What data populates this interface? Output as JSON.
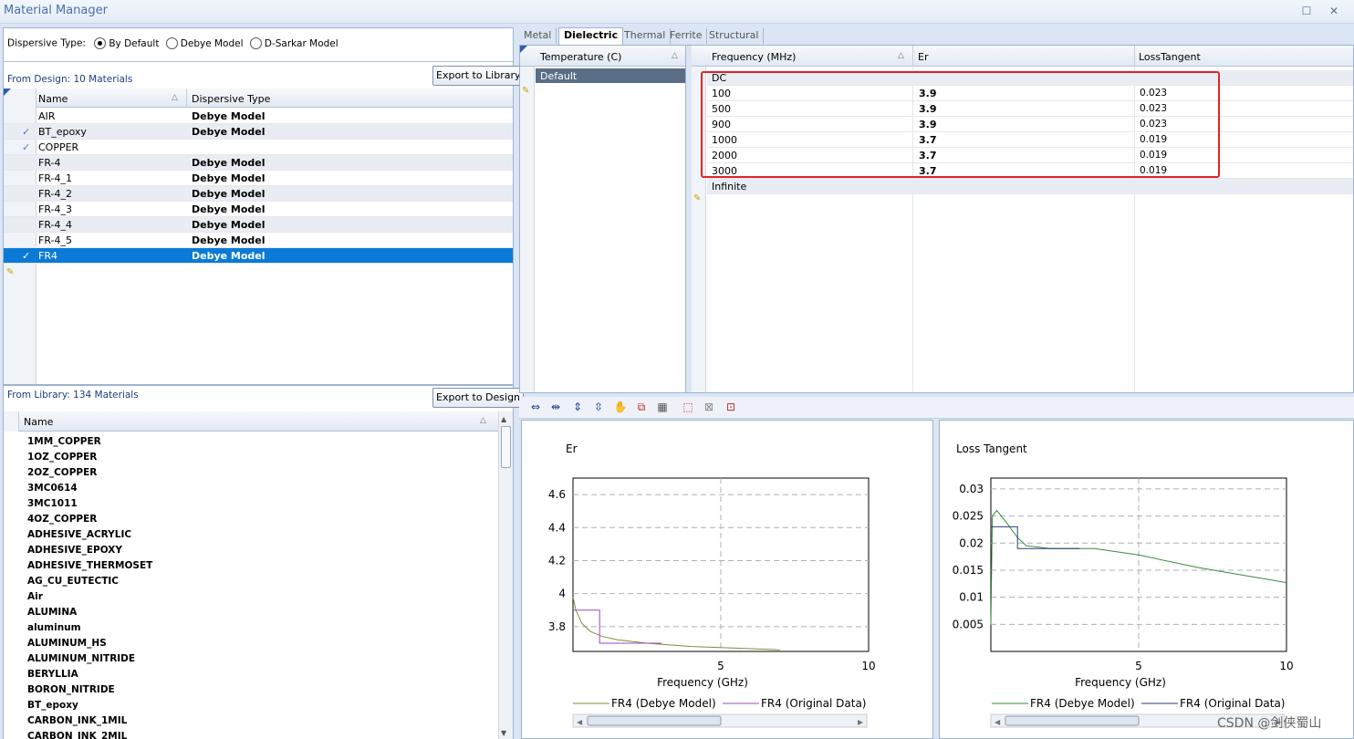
{
  "window": {
    "title": "Material Manager"
  },
  "left": {
    "dispersive_label": "Dispersive Type:",
    "options": [
      "By Default",
      "Debye Model",
      "D-Sarkar Model"
    ],
    "design_label": "From Design: 10 Materials",
    "export_library": "Export to Library",
    "design_cols": [
      "Name",
      "Dispersive Type"
    ],
    "design_rows": [
      {
        "name": "AIR",
        "type": "Debye Model",
        "check": ""
      },
      {
        "name": "BT_epoxy",
        "type": "Debye Model",
        "check": "✓"
      },
      {
        "name": "COPPER",
        "type": "",
        "check": "✓"
      },
      {
        "name": "FR-4",
        "type": "Debye Model",
        "check": ""
      },
      {
        "name": "FR-4_1",
        "type": "Debye Model",
        "check": ""
      },
      {
        "name": "FR-4_2",
        "type": "Debye Model",
        "check": ""
      },
      {
        "name": "FR-4_3",
        "type": "Debye Model",
        "check": ""
      },
      {
        "name": "FR-4_4",
        "type": "Debye Model",
        "check": ""
      },
      {
        "name": "FR-4_5",
        "type": "Debye Model",
        "check": ""
      },
      {
        "name": "FR4",
        "type": "Debye Model",
        "check": "✓"
      }
    ],
    "library_label": "From Library: 134 Materials",
    "export_design": "Export to Design",
    "library_col": "Name",
    "library_items": [
      "1MM_COPPER",
      "1OZ_COPPER",
      "2OZ_COPPER",
      "3MC0614",
      "3MC1011",
      "4OZ_COPPER",
      "ADHESIVE_ACRYLIC",
      "ADHESIVE_EPOXY",
      "ADHESIVE_THERMOSET",
      "AG_CU_EUTECTIC",
      "Air",
      "ALUMINA",
      "aluminum",
      "ALUMINUM_HS",
      "ALUMINUM_NITRIDE",
      "BERYLLIA",
      "BORON_NITRIDE",
      "BT_epoxy",
      "CARBON_INK_1MIL",
      "CARBON_INK_2MIL"
    ]
  },
  "tabs": [
    "Metal",
    "Dielectric",
    "Thermal",
    "Ferrite",
    "Structural"
  ],
  "temp": {
    "header": "Temperature (C)",
    "row": "Default"
  },
  "freq": {
    "cols": [
      "Frequency (MHz)",
      "Er",
      "LossTangent"
    ],
    "rows": [
      {
        "f": "DC",
        "er": "",
        "lt": ""
      },
      {
        "f": "100",
        "er": "3.9",
        "lt": "0.023"
      },
      {
        "f": "500",
        "er": "3.9",
        "lt": "0.023"
      },
      {
        "f": "900",
        "er": "3.9",
        "lt": "0.023"
      },
      {
        "f": "1000",
        "er": "3.7",
        "lt": "0.019"
      },
      {
        "f": "2000",
        "er": "3.7",
        "lt": "0.019"
      },
      {
        "f": "3000",
        "er": "3.7",
        "lt": "0.019"
      },
      {
        "f": "Infinite",
        "er": "",
        "lt": ""
      }
    ]
  },
  "toolbar_icons": [
    "pan-x-icon",
    "zoom-x-icon",
    "pan-y-icon",
    "zoom-y-icon",
    "hand-icon",
    "zoom-box-icon",
    "copy-chart-icon",
    "select-region-icon",
    "clear-icon",
    "reset-zoom-icon"
  ],
  "watermark": "CSDN @剑侠蜀山",
  "chart_data": [
    {
      "type": "line",
      "title": "Er",
      "xlabel": "Frequency (GHz)",
      "ylabel": "",
      "xlim": [
        0,
        10
      ],
      "ylim": [
        3.65,
        4.7
      ],
      "xticks": [
        "5",
        "10"
      ],
      "yticks": [
        "3.8",
        "4",
        "4.2",
        "4.4",
        "4.6"
      ],
      "grid": true,
      "legend": "bottom",
      "series": [
        {
          "name": "FR4 (Debye Model)",
          "color": "#7e8c3a",
          "x": [
            0,
            0.1,
            0.3,
            0.6,
            1.0,
            1.5,
            2.5,
            4,
            5.5,
            7
          ],
          "y": [
            3.98,
            3.9,
            3.82,
            3.77,
            3.74,
            3.72,
            3.7,
            3.68,
            3.67,
            3.66
          ]
        },
        {
          "name": "FR4 (Original Data)",
          "color": "#9a4cb8",
          "x": [
            0,
            0.1,
            0.5,
            0.9,
            0.9,
            1.0,
            2.0,
            3.0
          ],
          "y": [
            3.9,
            3.9,
            3.9,
            3.9,
            3.7,
            3.7,
            3.7,
            3.7
          ]
        }
      ]
    },
    {
      "type": "line",
      "title": "Loss Tangent",
      "xlabel": "Frequency (GHz)",
      "ylabel": "",
      "xlim": [
        0,
        10
      ],
      "ylim": [
        0,
        0.032
      ],
      "xticks": [
        "5",
        "10"
      ],
      "yticks": [
        "0.005",
        "0.01",
        "0.015",
        "0.02",
        "0.025",
        "0.03"
      ],
      "grid": true,
      "legend": "bottom",
      "series": [
        {
          "name": "FR4 (Debye Model)",
          "color": "#3a8a3a",
          "x": [
            0,
            0.05,
            0.2,
            0.5,
            0.9,
            1.2,
            2,
            3.5,
            5,
            7,
            10
          ],
          "y": [
            0.005,
            0.025,
            0.026,
            0.024,
            0.021,
            0.0195,
            0.019,
            0.019,
            0.0178,
            0.0155,
            0.0127
          ]
        },
        {
          "name": "FR4 (Original Data)",
          "color": "#2a3d7a",
          "x": [
            0,
            0.1,
            0.1,
            0.9,
            0.9,
            3.0
          ],
          "y": [
            0.023,
            0.023,
            0.023,
            0.023,
            0.019,
            0.019
          ]
        }
      ]
    }
  ]
}
